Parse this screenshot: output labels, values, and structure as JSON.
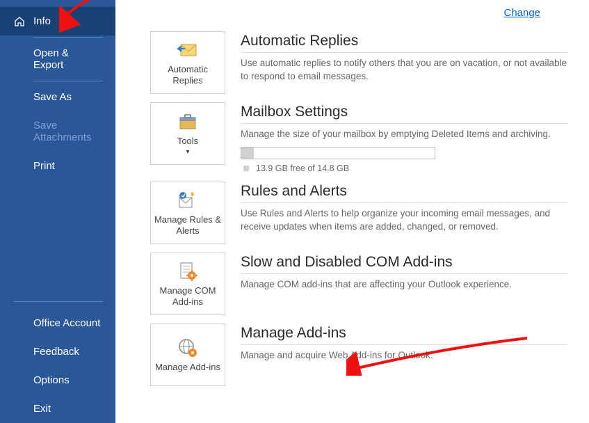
{
  "sidebar": {
    "items": [
      {
        "label": "Info",
        "selected": true,
        "icon": "home"
      },
      {
        "label": "Open & Export"
      },
      {
        "label": "Save As"
      },
      {
        "label": "Save Attachments",
        "disabled": true
      },
      {
        "label": "Print"
      },
      {
        "label": "Office Account"
      },
      {
        "label": "Feedback"
      },
      {
        "label": "Options"
      },
      {
        "label": "Exit"
      }
    ]
  },
  "header": {
    "change_link": "Change"
  },
  "sections": {
    "auto_replies": {
      "tile_label": "Automatic Replies",
      "title": "Automatic Replies",
      "desc": "Use automatic replies to notify others that you are on vacation, or not available to respond to email messages."
    },
    "mailbox": {
      "tile_label": "Tools",
      "title": "Mailbox Settings",
      "desc": "Manage the size of your mailbox by emptying Deleted Items and archiving.",
      "storage_text": "13.9 GB free of 14.8 GB"
    },
    "rules": {
      "tile_label": "Manage Rules & Alerts",
      "title": "Rules and Alerts",
      "desc": "Use Rules and Alerts to help organize your incoming email messages, and receive updates when items are added, changed, or removed."
    },
    "com_addins": {
      "tile_label": "Manage COM Add-ins",
      "title": "Slow and Disabled COM Add-ins",
      "desc": "Manage COM add-ins that are affecting your Outlook experience."
    },
    "manage_addins": {
      "tile_label": "Manage Add-ins",
      "title": "Manage Add-ins",
      "desc": "Manage and acquire Web Add-ins for Outlook."
    }
  }
}
